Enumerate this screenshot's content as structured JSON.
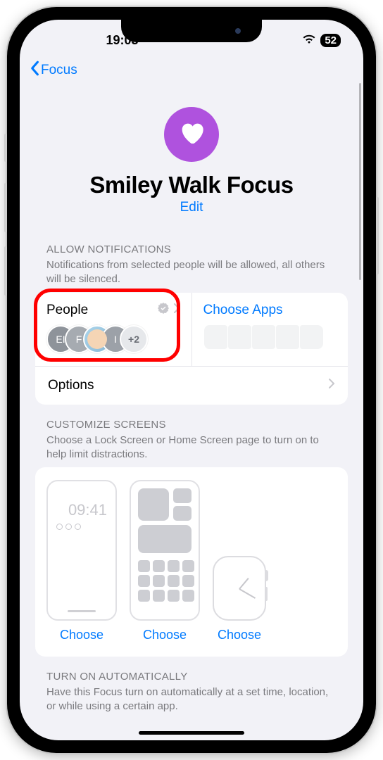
{
  "status": {
    "time": "19:03",
    "battery": "52"
  },
  "nav": {
    "back_label": "Focus"
  },
  "header": {
    "title": "Smiley Walk Focus",
    "edit": "Edit"
  },
  "notifications": {
    "header": "ALLOW NOTIFICATIONS",
    "desc": "Notifications from selected people will be allowed, all others will be silenced.",
    "people_label": "People",
    "apps_label": "Choose Apps",
    "avatars": [
      "EI",
      "F",
      "",
      "I"
    ],
    "more": "+2",
    "options_label": "Options"
  },
  "screens": {
    "header": "CUSTOMIZE SCREENS",
    "desc": "Choose a Lock Screen or Home Screen page to turn on to help limit distractions.",
    "lock_time": "09:41",
    "choose": "Choose"
  },
  "auto": {
    "header": "TURN ON AUTOMATICALLY",
    "desc": "Have this Focus turn on automatically at a set time, location, or while using a certain app."
  }
}
